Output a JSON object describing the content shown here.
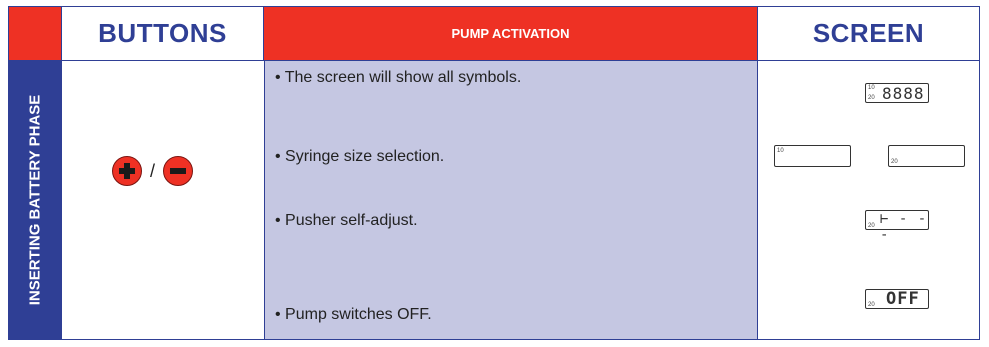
{
  "header": {
    "buttons_label": "BUTTONS",
    "pump_label": "PUMP ACTIVATION",
    "screen_label": "SCREEN"
  },
  "side_label": "INSERTING BATTERY PHASE",
  "buttons": {
    "plus_icon": "plus-circle-icon",
    "minus_icon": "minus-circle-icon",
    "separator": "/"
  },
  "pump_steps": [
    "• The screen will show all symbols.",
    "• Syringe size selection.",
    "• Pusher self-adjust.",
    "• Pump switches OFF."
  ],
  "screens": {
    "all_symbols": {
      "tiny_top": "10",
      "tiny_bottom": "20",
      "digits": "8888"
    },
    "size_10": {
      "tiny": "10"
    },
    "size_20": {
      "tiny": "20"
    },
    "pusher": {
      "tiny": "20",
      "segments": "⊢ - - -"
    },
    "off": {
      "tiny": "20",
      "text": "OFF"
    }
  },
  "colors": {
    "brand_blue": "#2f3f95",
    "accent_red": "#ee3124",
    "pump_bg": "#c5c7e2"
  }
}
